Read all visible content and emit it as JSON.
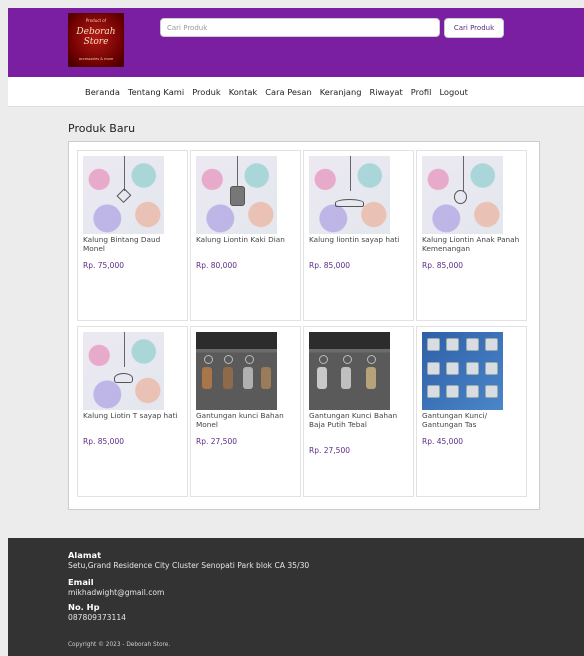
{
  "header": {
    "logo": {
      "top_text": "Product of",
      "title_line1": "Deborah",
      "title_line2": "Store",
      "bottom_text": "accessories & more"
    },
    "search": {
      "placeholder": "Cari Produk",
      "button_label": "Cari Produk"
    }
  },
  "nav": {
    "items": [
      "Beranda",
      "Tentang Kami",
      "Produk",
      "Kontak",
      "Cara Pesan",
      "Keranjang",
      "Riwayat",
      "Profil",
      "Logout"
    ]
  },
  "main": {
    "section_title": "Produk Baru",
    "products": [
      {
        "name": "Kalung Bintang Daud Monel",
        "price": "Rp. 75,000",
        "image": "necklace-photo"
      },
      {
        "name": "Kalung Liontin Kaki Dian",
        "price": "Rp. 80,000",
        "image": "necklace-photo"
      },
      {
        "name": "Kalung liontin sayap hati",
        "price": "Rp. 85,000",
        "image": "necklace-photo"
      },
      {
        "name": "Kalung Liontin Anak Panah Kemenangan",
        "price": "Rp. 85,000",
        "image": "necklace-photo"
      },
      {
        "name": "Kalung Liotin T sayap hati",
        "price": "Rp. 85,000",
        "image": "necklace-photo"
      },
      {
        "name": "Gantungan kunci Bahan Monel",
        "price": "Rp. 27,500",
        "image": "keychain-photo"
      },
      {
        "name": "Gantungan Kunci Bahan Baja Putih Tebal",
        "price": "Rp. 27,500",
        "image": "keychain-photo"
      },
      {
        "name": "Gantungan Kunci/ Gantungan Tas",
        "price": "Rp. 45,000",
        "image": "keychain-set-photo"
      }
    ]
  },
  "footer": {
    "address_label": "Alamat",
    "address": "Setu,Grand Residence City Cluster Senopati Park blok CA 35/30",
    "email_label": "Email",
    "email": "mikhadwight@gmail.com",
    "phone_label": "No. Hp",
    "phone": "087809373114",
    "copyright": "Copyright © 2023 - Deborah Store."
  },
  "colors": {
    "header_bg": "#7b1fa2",
    "price": "#5b2c83",
    "footer_bg": "#333333"
  }
}
